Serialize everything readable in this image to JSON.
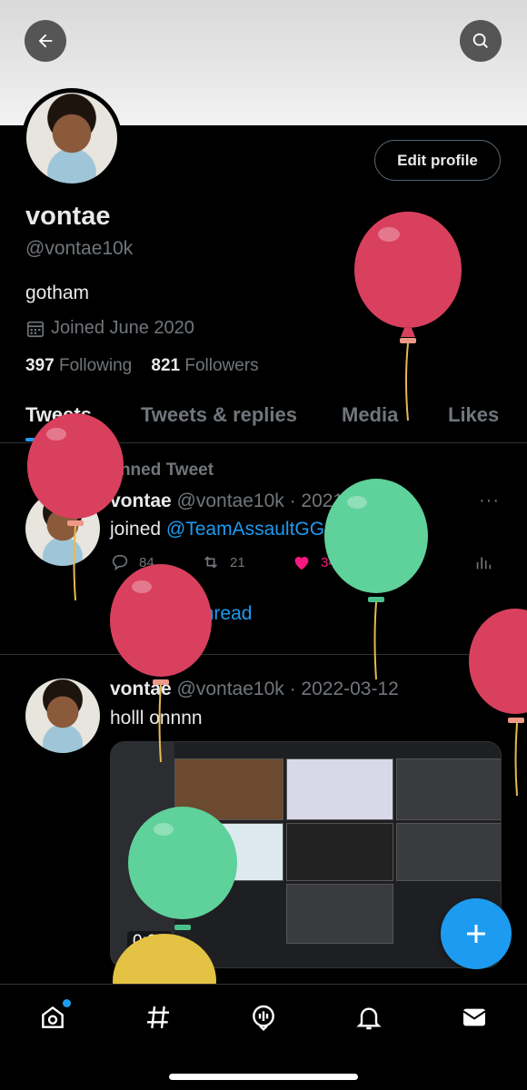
{
  "header": {
    "back_icon": "back-arrow-icon",
    "search_icon": "search-icon"
  },
  "profile": {
    "edit_label": "Edit profile",
    "name": "vontae",
    "handle": "@vontae10k",
    "bio": "gotham",
    "joined": "Joined June 2020",
    "following_count": "397",
    "following_label": "Following",
    "followers_count": "821",
    "followers_label": "Followers"
  },
  "tabs": [
    {
      "label": "Tweets"
    },
    {
      "label": "Tweets & replies"
    },
    {
      "label": "Media"
    },
    {
      "label": "Likes"
    }
  ],
  "pinned_label": "Pinned Tweet",
  "tweets": [
    {
      "name": "vontae",
      "meta": "@vontae10k · 2021-11-06",
      "text_prefix": "joined ",
      "mention": "@TeamAssaultGG",
      "replies": "84",
      "retweets": "21",
      "likes": "341",
      "thread_link": "Show this thread"
    },
    {
      "name": "vontae",
      "meta": "@vontae10k · 2022-03-12",
      "text": "holll onnnn",
      "media_duration": "0:25"
    }
  ],
  "more_glyph": "···",
  "colors": {
    "accent": "#1d9bf0",
    "like": "#f91880",
    "balloon_red": "#d9405e",
    "balloon_green": "#5fd19a",
    "balloon_yellow": "#e3c244"
  },
  "nav": [
    "home-icon",
    "explore-hashtag-icon",
    "spaces-icon",
    "notifications-bell-icon",
    "messages-mail-icon"
  ]
}
